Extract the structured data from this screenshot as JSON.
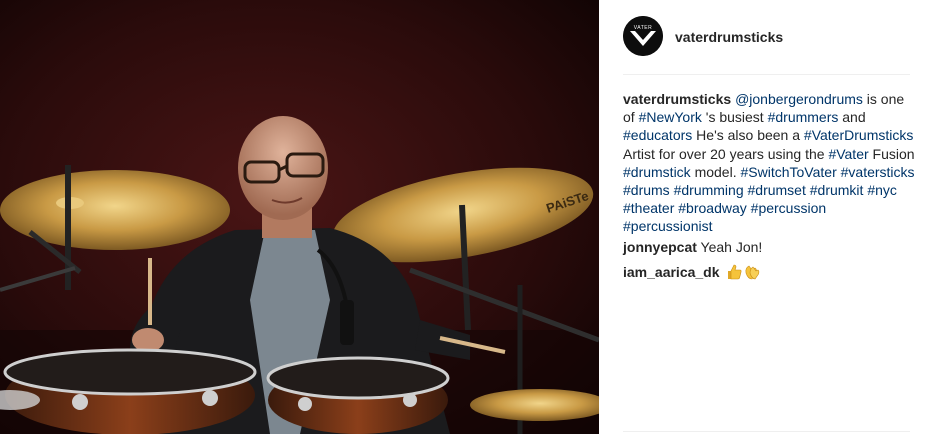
{
  "post": {
    "username": "vaterdrumsticks",
    "avatar_brand": "VATER",
    "caption": [
      {
        "text": "vaterdrumsticks",
        "type": "user"
      },
      {
        "text": " ",
        "type": "text"
      },
      {
        "text": "@jonbergerondrums",
        "type": "link"
      },
      {
        "text": " is one of ",
        "type": "text"
      },
      {
        "text": "#NewYork",
        "type": "link"
      },
      {
        "text": " 's busiest ",
        "type": "text"
      },
      {
        "text": "#drummers",
        "type": "link"
      },
      {
        "text": " and ",
        "type": "text"
      },
      {
        "text": "#educators",
        "type": "link"
      },
      {
        "text": " He's also been a ",
        "type": "text"
      },
      {
        "text": "#VaterDrumsticks",
        "type": "link"
      },
      {
        "text": " Artist for over 20 years using the ",
        "type": "text"
      },
      {
        "text": "#Vater",
        "type": "link"
      },
      {
        "text": " Fusion ",
        "type": "text"
      },
      {
        "text": "#drumstick",
        "type": "link"
      },
      {
        "text": " model. ",
        "type": "text"
      },
      {
        "text": "#SwitchToVater",
        "type": "link"
      },
      {
        "text": " ",
        "type": "text"
      },
      {
        "text": "#vatersticks",
        "type": "link"
      },
      {
        "text": " ",
        "type": "text"
      },
      {
        "text": "#drums",
        "type": "link"
      },
      {
        "text": " ",
        "type": "text"
      },
      {
        "text": "#drumming",
        "type": "link"
      },
      {
        "text": " ",
        "type": "text"
      },
      {
        "text": "#drumset",
        "type": "link"
      },
      {
        "text": " ",
        "type": "text"
      },
      {
        "text": "#drumkit",
        "type": "link"
      },
      {
        "text": " ",
        "type": "text"
      },
      {
        "text": "#nyc",
        "type": "link"
      },
      {
        "text": " ",
        "type": "text"
      },
      {
        "text": "#theater",
        "type": "link"
      },
      {
        "text": " ",
        "type": "text"
      },
      {
        "text": "#broadway",
        "type": "link"
      },
      {
        "text": " ",
        "type": "text"
      },
      {
        "text": "#percussion",
        "type": "link"
      },
      {
        "text": " ",
        "type": "text"
      },
      {
        "text": "#percussionist",
        "type": "link"
      }
    ]
  },
  "comments": [
    {
      "user": "jonnyepcat",
      "text": "Yeah Jon!"
    },
    {
      "user": "iam_aarica_dk",
      "text": "",
      "emojis": [
        "thumbs-up-emoji",
        "clapping-hands-emoji"
      ]
    }
  ],
  "photo": {
    "cymbal_logo": "PAiSTe"
  },
  "colors": {
    "link": "#003569",
    "text": "#262626",
    "divider": "#efefef",
    "emoji": "#f5c33b"
  }
}
